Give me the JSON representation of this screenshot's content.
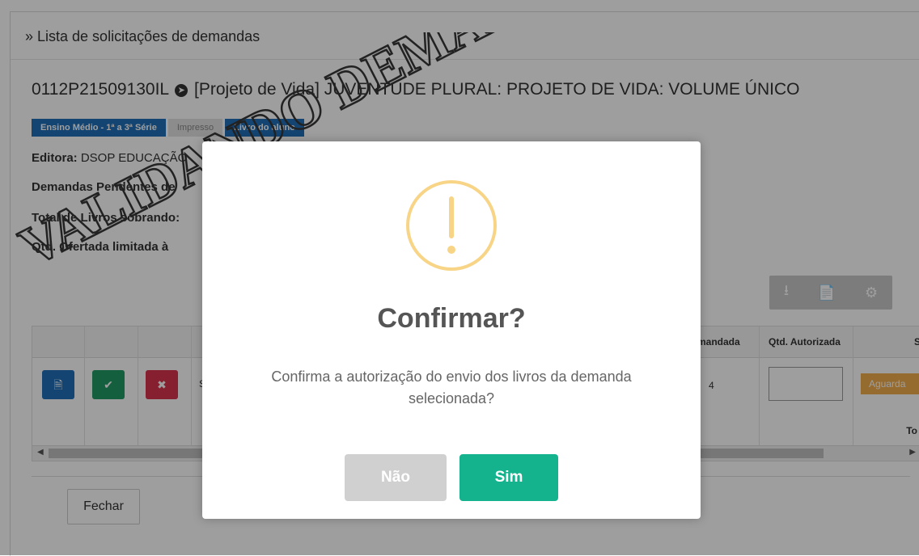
{
  "breadcrumb": "» Lista de solicitações de demandas",
  "book": {
    "code": "0112P21509130IL",
    "title": "[Projeto de Vida] JUVENTUDE PLURAL: PROJETO DE VIDA: VOLUME ÚNICO"
  },
  "badges": [
    "Ensino Médio - 1ª a 3ª Série",
    "Impresso",
    "Livro do aluno"
  ],
  "info": {
    "editora_label": "Editora:",
    "editora_value": "DSOP EDUCAÇÃO",
    "demandas_label": "Demandas Pendentes de",
    "total_label": "Total de Livros sobrando:",
    "qtd_label": "Qtd. Ofertada limitada à"
  },
  "toolbar": {
    "icons": [
      "download-icon",
      "file-icon",
      "gear-icon"
    ]
  },
  "table": {
    "headers": {
      "demandada": "mandada",
      "autorizada": "Qtd. Autorizada",
      "status": "S"
    },
    "row": {
      "col_s": "S",
      "demandada_value": "4",
      "status_label": "Aguarda"
    },
    "footer_total": "To"
  },
  "fechar_label": "Fechar",
  "watermark": "VALIDANDO DEMANDA",
  "modal": {
    "title": "Confirmar?",
    "text": "Confirma a autorização do envio dos livros da demanda selecionada?",
    "no_label": "Não",
    "yes_label": "Sim"
  },
  "colors": {
    "accent_green": "#14b38e",
    "warning": "#f8d486",
    "badge_blue": "#1f6fb8",
    "status_orange": "#f0ad4e",
    "btn_red": "#d9334d",
    "btn_green": "#1f9a64"
  }
}
